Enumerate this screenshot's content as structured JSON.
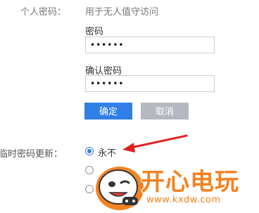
{
  "personal_password": {
    "label": "个人密码：",
    "description": "用于无人值守访问",
    "password_label": "密码",
    "password_value": "••••••",
    "confirm_label": "确认密码",
    "confirm_value": "••••••",
    "ok_button": "确定",
    "cancel_button": "取消"
  },
  "temp_password": {
    "label": "临时密码更新：",
    "options": [
      {
        "label": "永不",
        "selected": true
      },
      {
        "label": "",
        "selected": false
      },
      {
        "label": "",
        "selected": false
      }
    ]
  },
  "annotation": {
    "arrow_color": "#e02020"
  },
  "watermark": {
    "brand": "开心电玩",
    "url": "www.kxdw.com",
    "color": "#f58220"
  }
}
